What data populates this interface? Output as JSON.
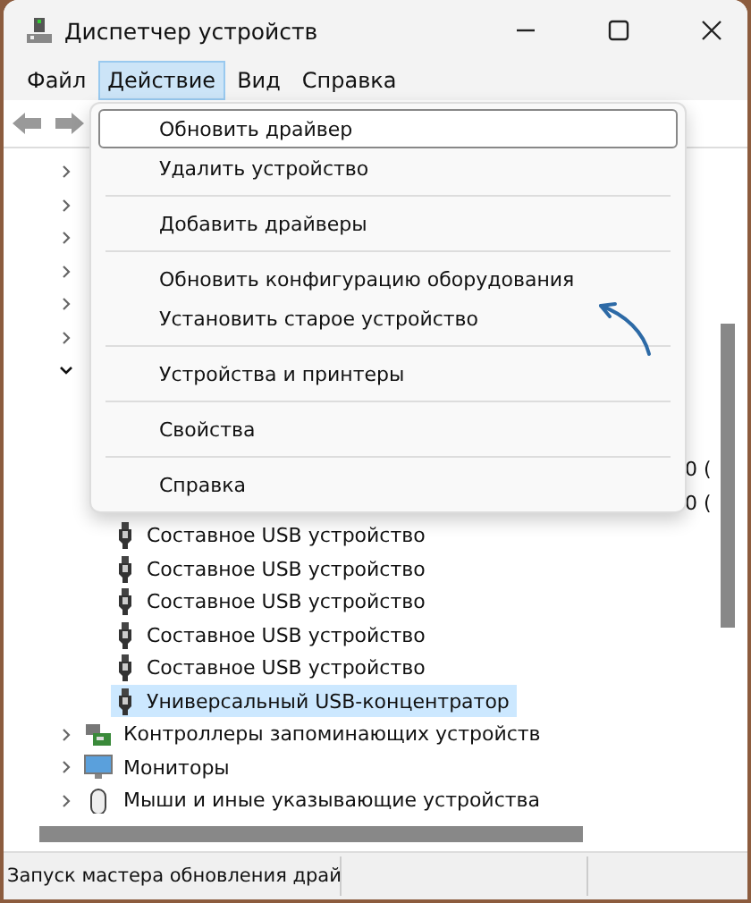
{
  "window": {
    "title": "Диспетчер устройств"
  },
  "menu_bar": [
    {
      "label": "Файл",
      "selected": false
    },
    {
      "label": "Действие",
      "selected": true
    },
    {
      "label": "Вид",
      "selected": false
    },
    {
      "label": "Справка",
      "selected": false
    }
  ],
  "tree": [
    {
      "expanded": false
    },
    {
      "expanded": false
    },
    {
      "expanded": false
    },
    {
      "expanded": false
    },
    {
      "expanded": false
    },
    {
      "expanded": false
    },
    {
      "expanded": true,
      "children": [
        {
          "trailing": "0 ("
        },
        {
          "trailing": "0 ("
        },
        {
          "label": "Составное USB устройство",
          "selected": false
        },
        {
          "label": "Составное USB устройство",
          "selected": false
        },
        {
          "label": "Составное USB устройство",
          "selected": false
        },
        {
          "label": "Составное USB устройство",
          "selected": false
        },
        {
          "label": "Составное USB устройство",
          "selected": false
        },
        {
          "label": "Универсальный USB-концентратор",
          "selected": true
        }
      ]
    },
    {
      "expanded": false,
      "label": "Контроллеры запоминающих устройств",
      "kind": "storage"
    },
    {
      "expanded": false,
      "label": "Мониторы",
      "kind": "monitor"
    },
    {
      "expanded": false,
      "label": "Мыши и иные указывающие устройства",
      "kind": "mouse"
    }
  ],
  "dropdown_menu": [
    [
      {
        "label": "Обновить драйвер",
        "selected": true
      },
      {
        "label": "Удалить устройство",
        "selected": false
      }
    ],
    [
      {
        "label": "Добавить драйверы",
        "selected": false
      }
    ],
    [
      {
        "label": "Обновить конфигурацию оборудования",
        "selected": false
      },
      {
        "label": "Установить старое устройство",
        "selected": false
      }
    ],
    [
      {
        "label": "Устройства и принтеры",
        "selected": false
      }
    ],
    [
      {
        "label": "Свойства",
        "selected": false
      }
    ],
    [
      {
        "label": "Справка",
        "selected": false
      }
    ]
  ],
  "status_bar": {
    "text": "Запуск мастера обновления драй"
  }
}
